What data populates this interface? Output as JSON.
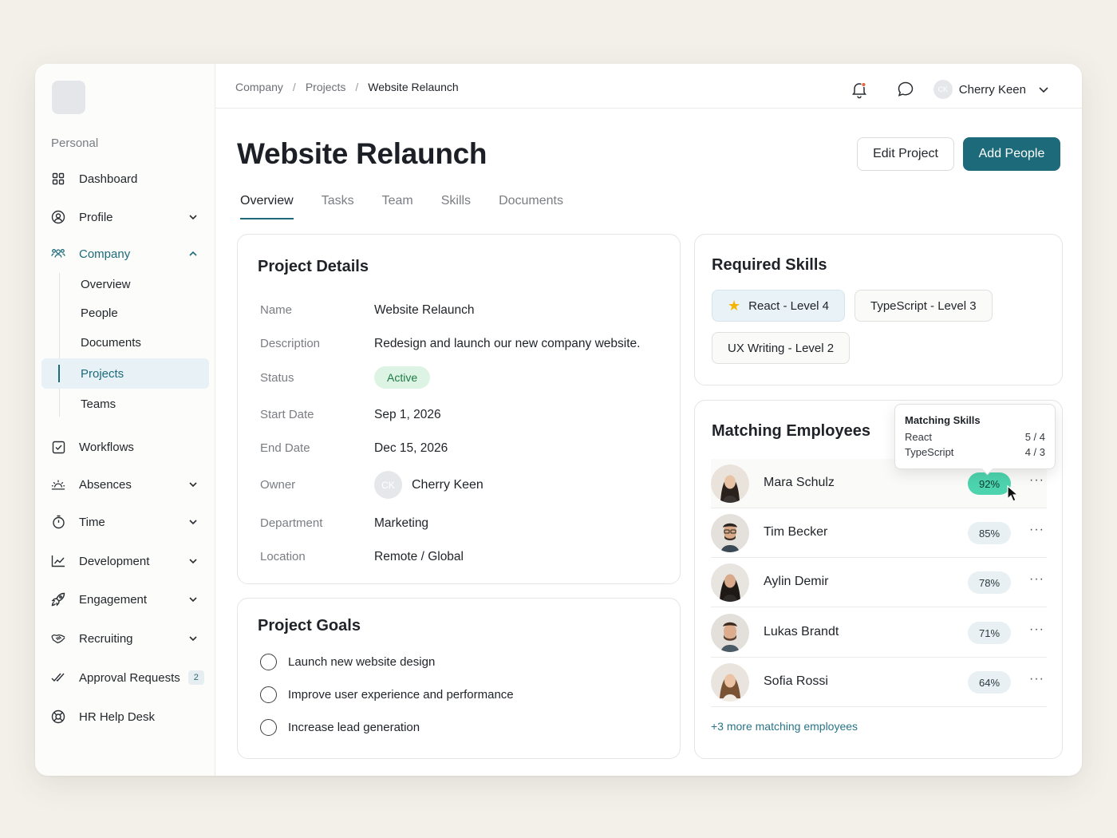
{
  "sidebar": {
    "section_label": "Personal",
    "items": {
      "dashboard": "Dashboard",
      "profile": "Profile",
      "company": "Company",
      "workflows": "Workflows",
      "absences": "Absences",
      "time": "Time",
      "development": "Development",
      "engagement": "Engagement",
      "recruiting": "Recruiting",
      "approval_requests": "Approval Requests",
      "approval_count": "2",
      "hr_help_desk": "HR Help Desk"
    },
    "company_sub": [
      "Overview",
      "People",
      "Documents",
      "Projects",
      "Teams"
    ],
    "selected_sub": "Projects",
    "accent_color": "#1d6a7a"
  },
  "header": {
    "breadcrumb": [
      "Company",
      "Projects",
      "Website Relaunch"
    ],
    "breadcrumb_sep": "/",
    "user_initials": "CK",
    "user_name": "Cherry Keen"
  },
  "page": {
    "title": "Website Relaunch",
    "edit_label": "Edit Project",
    "add_label": "Add People",
    "tabs": [
      "Overview",
      "Tasks",
      "Team",
      "Skills",
      "Documents"
    ],
    "active_tab": "Overview"
  },
  "details": {
    "title": "Project Details",
    "labels": {
      "name": "Name",
      "description": "Description",
      "status": "Status",
      "start": "Start Date",
      "end": "End Date",
      "owner": "Owner",
      "department": "Department",
      "location": "Location"
    },
    "values": {
      "name": "Website Relaunch",
      "description": "Redesign and launch our new company website.",
      "status": "Active",
      "start": "Sep 1, 2026",
      "end": "Dec 15, 2026",
      "owner_initials": "CK",
      "owner": "Cherry Keen",
      "department": "Marketing",
      "location": "Remote / Global"
    }
  },
  "goals": {
    "title": "Project Goals",
    "items": [
      "Launch new website design",
      "Improve user experience and performance",
      "Increase lead generation"
    ]
  },
  "skills": {
    "title": "Required Skills",
    "items": [
      "React - Level 4",
      "TypeScript - Level 3",
      "UX Writing - Level 2"
    ]
  },
  "matching": {
    "title": "Matching Employees",
    "employees": [
      {
        "name": "Mara Schulz",
        "pct": "92%"
      },
      {
        "name": "Tim Becker",
        "pct": "85%"
      },
      {
        "name": "Aylin Demir",
        "pct": "78%"
      },
      {
        "name": "Lukas Brandt",
        "pct": "71%"
      },
      {
        "name": "Sofia Rossi",
        "pct": "64%"
      }
    ],
    "more": "+3 more matching employees",
    "menu": "···",
    "tooltip": {
      "title": "Matching Skills",
      "rows": [
        {
          "skill": "React",
          "value": "5 / 4"
        },
        {
          "skill": "TypeScript",
          "value": "4 / 3"
        }
      ]
    }
  }
}
